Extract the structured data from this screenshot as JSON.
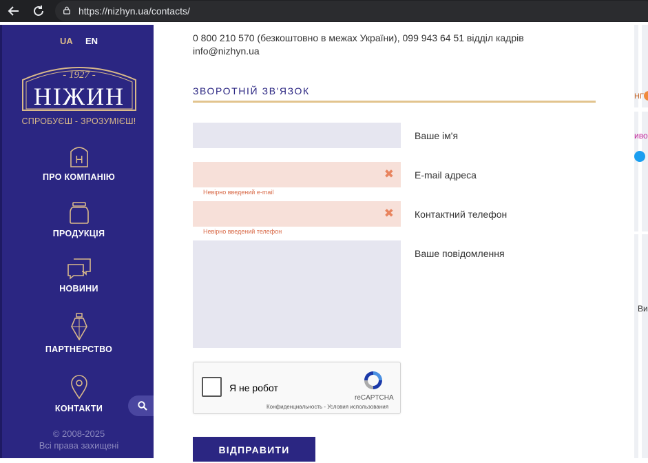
{
  "browser": {
    "url": "https://nizhyn.ua/contacts/",
    "back_icon": "arrow-left-icon",
    "reload_icon": "reload-icon",
    "lock_icon": "lock-icon"
  },
  "sidebar": {
    "langs": [
      "UA",
      "EN"
    ],
    "logo": {
      "year": "- 1927 -",
      "name": "НІЖИН"
    },
    "tagline": "СПРОБУЄШ - ЗРОЗУМІЄШ!",
    "nav": [
      {
        "label": "ПРО КОМПАНІЮ",
        "icon": "letter-h-icon"
      },
      {
        "label": "ПРОДУКЦІЯ",
        "icon": "jar-icon"
      },
      {
        "label": "НОВИНИ",
        "icon": "chat-bubbles-icon"
      },
      {
        "label": "ПАРТНЕРСТВО",
        "icon": "handshake-icon"
      },
      {
        "label": "КОНТАКТИ",
        "icon": "location-pin-icon"
      }
    ],
    "search_icon": "search-icon",
    "copyright": [
      "© 2008-2025",
      "Всі права захищені"
    ]
  },
  "contacts": {
    "phone_line": "0 800 210 570 (безкоштовно в межах України), 099 943 64 51 відділ кадрів",
    "email": "info@nizhyn.ua"
  },
  "form": {
    "title": "ЗВОРОТНІЙ ЗВ'ЯЗОК",
    "fields": [
      {
        "label": "Ваше ім'я",
        "value": "",
        "error": ""
      },
      {
        "label": "E-mail адреса",
        "value": "",
        "error": "Невірно введений e-mail"
      },
      {
        "label": "Контактний телефон",
        "value": "",
        "error": "Невірно введений телефон"
      },
      {
        "label": "Ваше повідомлення",
        "value": "",
        "error": ""
      }
    ],
    "recaptcha": {
      "label": "Я не робот",
      "brand": "reCAPTCHA",
      "links": "Конфиденциальность - Условия использования"
    },
    "submit_label": "ВІДПРАВИТИ"
  },
  "map": {
    "labels": [
      "НГ",
      "иво",
      "Ви"
    ]
  },
  "colors": {
    "sidebar": "#2b2682",
    "gold": "#d9b98a",
    "error": "#e8845f"
  }
}
